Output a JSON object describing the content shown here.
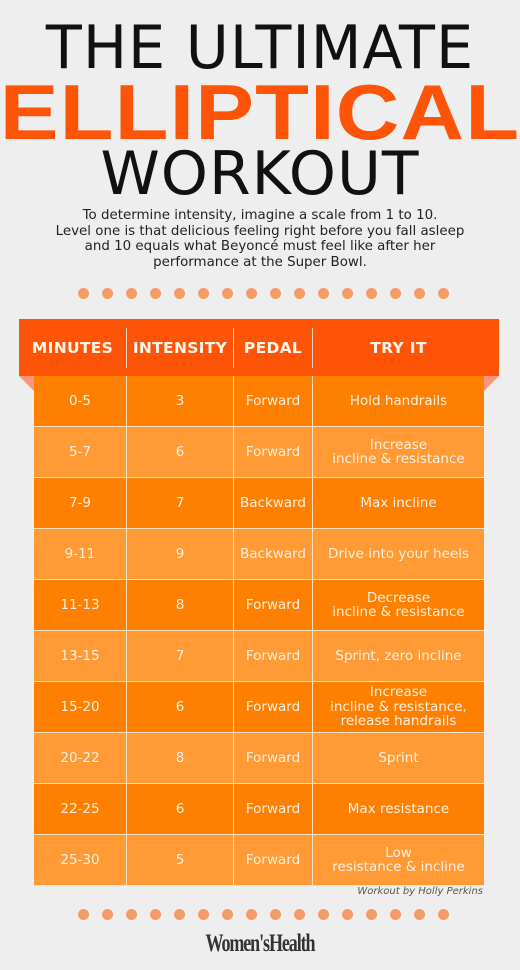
{
  "title": {
    "line1": "THE ULTIMATE",
    "line2": "ELLIPTICAL",
    "line3": "WORKOUT"
  },
  "intro": {
    "lines": [
      "To determine intensity, imagine a scale from 1 to 10.",
      "Level one is that delicious feeling right before you fall asleep",
      "and 10 equals what Beyoncé must feel like after her",
      "performance at the Super Bowl."
    ]
  },
  "colors": {
    "accent": "#fd5407",
    "row_dark": "#ff7f00",
    "row_light": "#ff9a35",
    "dots": "#f59b68"
  },
  "decor": {
    "dot_count": 16
  },
  "table": {
    "headers": [
      "MINUTES",
      "INTENSITY",
      "PEDAL",
      "TRY IT"
    ],
    "rows": [
      {
        "minutes": "0-5",
        "intensity": "3",
        "pedal": "Forward",
        "try_it": "Hold handrails"
      },
      {
        "minutes": "5-7",
        "intensity": "6",
        "pedal": "Forward",
        "try_it": "Increase\nincline & resistance"
      },
      {
        "minutes": "7-9",
        "intensity": "7",
        "pedal": "Backward",
        "try_it": "Max incline"
      },
      {
        "minutes": "9-11",
        "intensity": "9",
        "pedal": "Backward",
        "try_it": "Drive into your heels"
      },
      {
        "minutes": "11-13",
        "intensity": "8",
        "pedal": "Forward",
        "try_it": "Decrease\nincline & resistance"
      },
      {
        "minutes": "13-15",
        "intensity": "7",
        "pedal": "Forward",
        "try_it": "Sprint, zero incline"
      },
      {
        "minutes": "15-20",
        "intensity": "6",
        "pedal": "Forward",
        "try_it": "Increase\nincline & resistance,\nrelease handrails"
      },
      {
        "minutes": "20-22",
        "intensity": "8",
        "pedal": "Forward",
        "try_it": "Sprint"
      },
      {
        "minutes": "22-25",
        "intensity": "6",
        "pedal": "Forward",
        "try_it": "Max resistance"
      },
      {
        "minutes": "25-30",
        "intensity": "5",
        "pedal": "Forward",
        "try_it": "Low\nresistance & incline"
      }
    ]
  },
  "credit": "Workout by Holly Perkins",
  "logo": "Women'sHealth"
}
